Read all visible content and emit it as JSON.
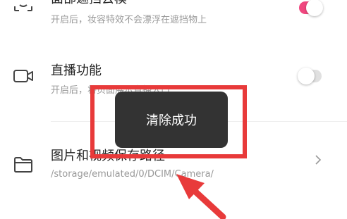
{
  "settings": {
    "face_blur": {
      "title": "面部遮挡去模",
      "subtitle": "开启后，妆容特效不会漂浮在遮挡物上",
      "toggle_on": true,
      "icon": "face-frame-icon"
    },
    "live": {
      "title": "直播功能",
      "subtitle": "开启后，将页面展示直播入口",
      "toggle_on": false,
      "icon": "video-camera-icon"
    },
    "save_path": {
      "title": "图片和视频保存路径",
      "subtitle": "/storage/emulated/0/DCIM/Camera/",
      "icon": "folder-icon"
    }
  },
  "toast": {
    "message": "清除成功"
  },
  "colors": {
    "accent": "#f0477f",
    "toggle_off": "#e0e0e0",
    "annotation_red": "#e83a3a",
    "toast_bg": "#333333"
  }
}
